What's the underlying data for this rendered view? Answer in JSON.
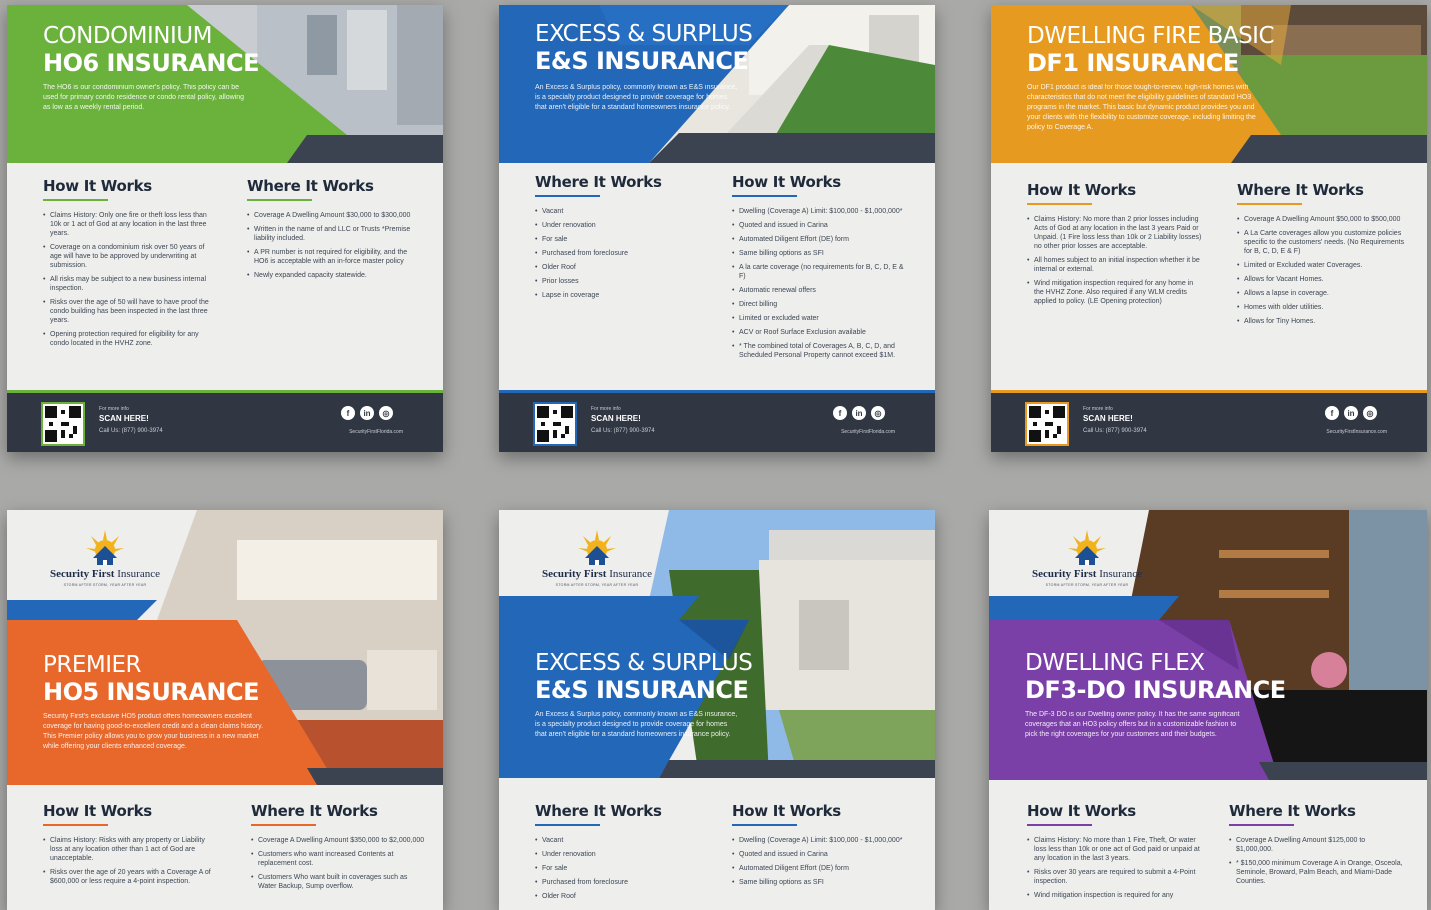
{
  "flyers": {
    "ho6": {
      "title1": "CONDOMINIUM",
      "title2": "HO6 INSURANCE",
      "description": "The HO6 is our condominium owner's policy. This policy can be used for primary condo residence or condo rental policy, allowing as low as a weekly rental period.",
      "left_heading": "How It Works",
      "left_items": [
        "Claims History: Only one fire or theft loss less than 10k or 1 act of God at any location in the last three years.",
        "Coverage on a condominium risk over 50 years of age will have to be approved by underwriting at submission.",
        "All risks may be subject to a new business internal inspection.",
        "Risks over the age of 50 will have to have proof the condo building has been inspected in the last three years.",
        "Opening protection required for eligibility for any condo located in the HVHZ zone."
      ],
      "right_heading": "Where It Works",
      "right_items": [
        "Coverage A Dwelling Amount $30,000 to $300,000",
        "Written in the name of and LLC or Trusts *Premise liability included.",
        "A PR number is not required for eligibility, and the HO6 is acceptable with an in-force master policy",
        "Newly expanded capacity statewide."
      ],
      "scan_small": "For more info",
      "scan": "SCAN HERE!",
      "phone": "Call Us: (877) 900-3974",
      "site": "SecurityFirstFlorida.com"
    },
    "es1": {
      "title1": "EXCESS & SURPLUS",
      "title2": "E&S INSURANCE",
      "description": "An Excess & Surplus policy, commonly known as E&S insurance, is a specialty product designed to provide coverage for homes that aren't eligible for a standard homeowners insurance policy.",
      "left_heading": "Where It Works",
      "left_items": [
        "Vacant",
        "Under renovation",
        "For sale",
        "Purchased from foreclosure",
        "Older Roof",
        "Prior losses",
        "Lapse in coverage"
      ],
      "right_heading": "How It Works",
      "right_items": [
        "Dwelling (Coverage A) Limit: $100,000 - $1,000,000*",
        "Quoted and issued in Carina",
        "Automated Diligent Effort (DE) form",
        "Same billing options as SFI",
        "A la carte coverage (no requirements for B, C, D, E & F)",
        "Automatic renewal offers",
        "Direct billing",
        "Limited or excluded water",
        "ACV or Roof Surface Exclusion available",
        "* The combined total of Coverages A, B, C, D, and Scheduled Personal Property cannot exceed $1M."
      ],
      "scan_small": "For more info",
      "scan": "SCAN HERE!",
      "phone": "Call Us: (877) 900-3974",
      "site": "SecurityFirstFlorida.com"
    },
    "df1": {
      "title1": "DWELLING FIRE BASIC",
      "title2": "DF1 INSURANCE",
      "description": "Our DF1 product is ideal for those tough-to-renew, high-risk homes with characteristics that do not meet the eligibility guidelines of standard HO3 programs in the market. This basic but dynamic product provides you and your clients with the flexibility to customize coverage, including limiting the policy to Coverage A.",
      "left_heading": "How It Works",
      "left_items": [
        "Claims History: No more than 2 prior losses including Acts of God at any location in the last 3 years Paid or Unpaid. (1 Fire loss less than 10k or 2 Liability losses) no other prior losses are acceptable.",
        "All homes subject to an initial inspection whether it be internal or external.",
        "Wind mitigation inspection required for any home in the HVHZ Zone. Also required if any WLM credits applied to policy. (LE Opening protection)"
      ],
      "right_heading": "Where It Works",
      "right_items": [
        "Coverage A Dwelling Amount $50,000 to $500,000",
        "A La Carte coverages allow you customize policies specific to the customers' needs. (No Requirements for B, C, D, E & F)",
        "Limited or Excluded water Coverages.",
        "Allows for Vacant Homes.",
        "Allows a lapse in coverage.",
        "Homes with older utilities.",
        "Allows for Tiny Homes."
      ],
      "scan_small": "For more info",
      "scan": "SCAN HERE!",
      "phone": "Call Us: (877) 900-3974",
      "site": "SecurityFirstInsurance.com"
    },
    "ho5": {
      "logo_name": "Security First",
      "logo_name2": " Insurance",
      "logo_tag": "STORM AFTER STORM, YEAR AFTER YEAR",
      "title1": "PREMIER",
      "title2": "HO5 INSURANCE",
      "description": "Security First's exclusive HO5 product offers homeowners excellent coverage for having good-to-excellent credit and a clean claims history. This Premier policy allows you to grow your business in a new market while offering your clients enhanced coverage.",
      "left_heading": "How It Works",
      "left_items": [
        "Claims History: Risks with any property or Liability loss at any location other than 1 act of God are unacceptable.",
        "Risks over the age of 20 years with a Coverage A of $600,000 or less require a 4-point inspection."
      ],
      "right_heading": "Where It Works",
      "right_items": [
        "Coverage A Dwelling Amount $350,000 to $2,000,000",
        "Customers who want increased Contents at replacement cost.",
        "Customers Who want built in coverages such as Water Backup, Sump overflow."
      ]
    },
    "es2": {
      "logo_name": "Security First",
      "logo_name2": " Insurance",
      "logo_tag": "STORM AFTER STORM, YEAR AFTER YEAR",
      "title1": "EXCESS & SURPLUS",
      "title2": "E&S INSURANCE",
      "description": "An Excess & Surplus policy, commonly known as E&S insurance, is a specialty product designed to provide coverage for homes that aren't eligible for a standard homeowners insurance policy.",
      "left_heading": "Where It Works",
      "left_items": [
        "Vacant",
        "Under renovation",
        "For sale",
        "Purchased from foreclosure",
        "Older Roof"
      ],
      "right_heading": "How It Works",
      "right_items": [
        "Dwelling (Coverage A) Limit: $100,000 - $1,000,000*",
        "Quoted and issued in Carina",
        "Automated Diligent Effort (DE) form",
        "Same billing options as SFI"
      ]
    },
    "df3": {
      "logo_name": "Security First",
      "logo_name2": " Insurance",
      "logo_tag": "STORM AFTER STORM, YEAR AFTER YEAR",
      "title1": "DWELLING FLEX",
      "title2": "DF3-DO INSURANCE",
      "description": "The DF-3 DO is our Dwelling owner policy. It has the same significant coverages that an HO3 policy offers but in a customizable fashion to pick the right coverages for your customers and their budgets.",
      "left_heading": "How It Works",
      "left_items": [
        "Claims History: No more than 1 Fire, Theft, Or water loss less than 10k or one act of God paid or unpaid at any location in the last 3 years.",
        "Risks over 30 years are required to submit a 4-Point inspection.",
        "Wind mitigation inspection is required for any"
      ],
      "right_heading": "Where It Works",
      "right_items": [
        "Coverage A Dwelling Amount $125,000 to $1,000,000.",
        "* $150,000 minimum Coverage A in Orange, Osceola, Seminole, Broward, Palm Beach, and Miami-Dade Counties."
      ]
    }
  },
  "colors": {
    "green": "#6ab23c",
    "blue": "#2367b8",
    "orange": "#e79a20",
    "orange_red": "#e8672a",
    "purple": "#7b3fa8",
    "dark_blue": "#1f5fb0",
    "footer": "#303642"
  }
}
